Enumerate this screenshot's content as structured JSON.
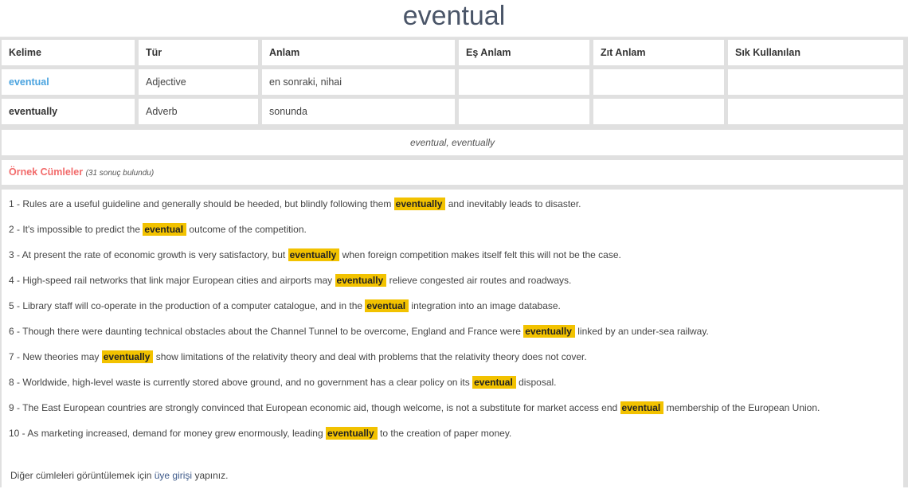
{
  "page_title": "eventual",
  "table": {
    "headers": [
      "Kelime",
      "Tür",
      "Anlam",
      "Eş Anlam",
      "Zıt Anlam",
      "Sık Kullanılan"
    ],
    "rows": [
      {
        "word": "eventual",
        "type": "Adjective",
        "meaning": "en sonraki, nihai",
        "synonym": "",
        "antonym": "",
        "common": ""
      },
      {
        "word": "eventually",
        "type": "Adverb",
        "meaning": "sonunda",
        "synonym": "",
        "antonym": "",
        "common": ""
      }
    ]
  },
  "word_forms": "eventual, eventually",
  "examples": {
    "label": "Örnek Cümleler",
    "count_text": "(31 sonuç bulundu)",
    "highlight_color": "#f2c200",
    "sentences": [
      {
        "pre": "1 - Rules are a useful guideline and generally should be heeded, but blindly following them",
        "hl": "eventually",
        "post": "and inevitably leads to disaster."
      },
      {
        "pre": "2 - It's impossible to predict the",
        "hl": "eventual",
        "post": "outcome of the competition."
      },
      {
        "pre": "3 - At present the rate of economic growth is very satisfactory, but",
        "hl": "eventually",
        "post": "when foreign competition makes itself felt this will not be the case."
      },
      {
        "pre": "4 - High-speed rail networks that link major European cities and airports may",
        "hl": "eventually",
        "post": "relieve congested air routes and roadways."
      },
      {
        "pre": "5 - Library staff will co-operate in the production of a computer catalogue, and in the",
        "hl": "eventual",
        "post": "integration into an image database."
      },
      {
        "pre": "6 - Though there were daunting technical obstacles about the Channel Tunnel to be overcome, England and France were",
        "hl": "eventually",
        "post": "linked by an under-sea railway."
      },
      {
        "pre": "7 - New theories may",
        "hl": "eventually",
        "post": "show limitations of the relativity theory and deal with problems that the relativity theory does not cover."
      },
      {
        "pre": "8 - Worldwide, high-level waste is currently stored above ground, and no government has a clear policy on its",
        "hl": "eventual",
        "post": "disposal."
      },
      {
        "pre": "9 - The East European countries are strongly convinced that European economic aid, though welcome, is not a substitute for market access end",
        "hl": "eventual",
        "post": "membership of the European Union."
      },
      {
        "pre": "10 - As marketing increased, demand for money grew enormously, leading",
        "hl": "eventually",
        "post": "to the creation of paper money."
      }
    ]
  },
  "footer": {
    "pre": "Diğer cümleleri görüntülemek için",
    "link": "üye girişi",
    "post": "yapınız."
  }
}
